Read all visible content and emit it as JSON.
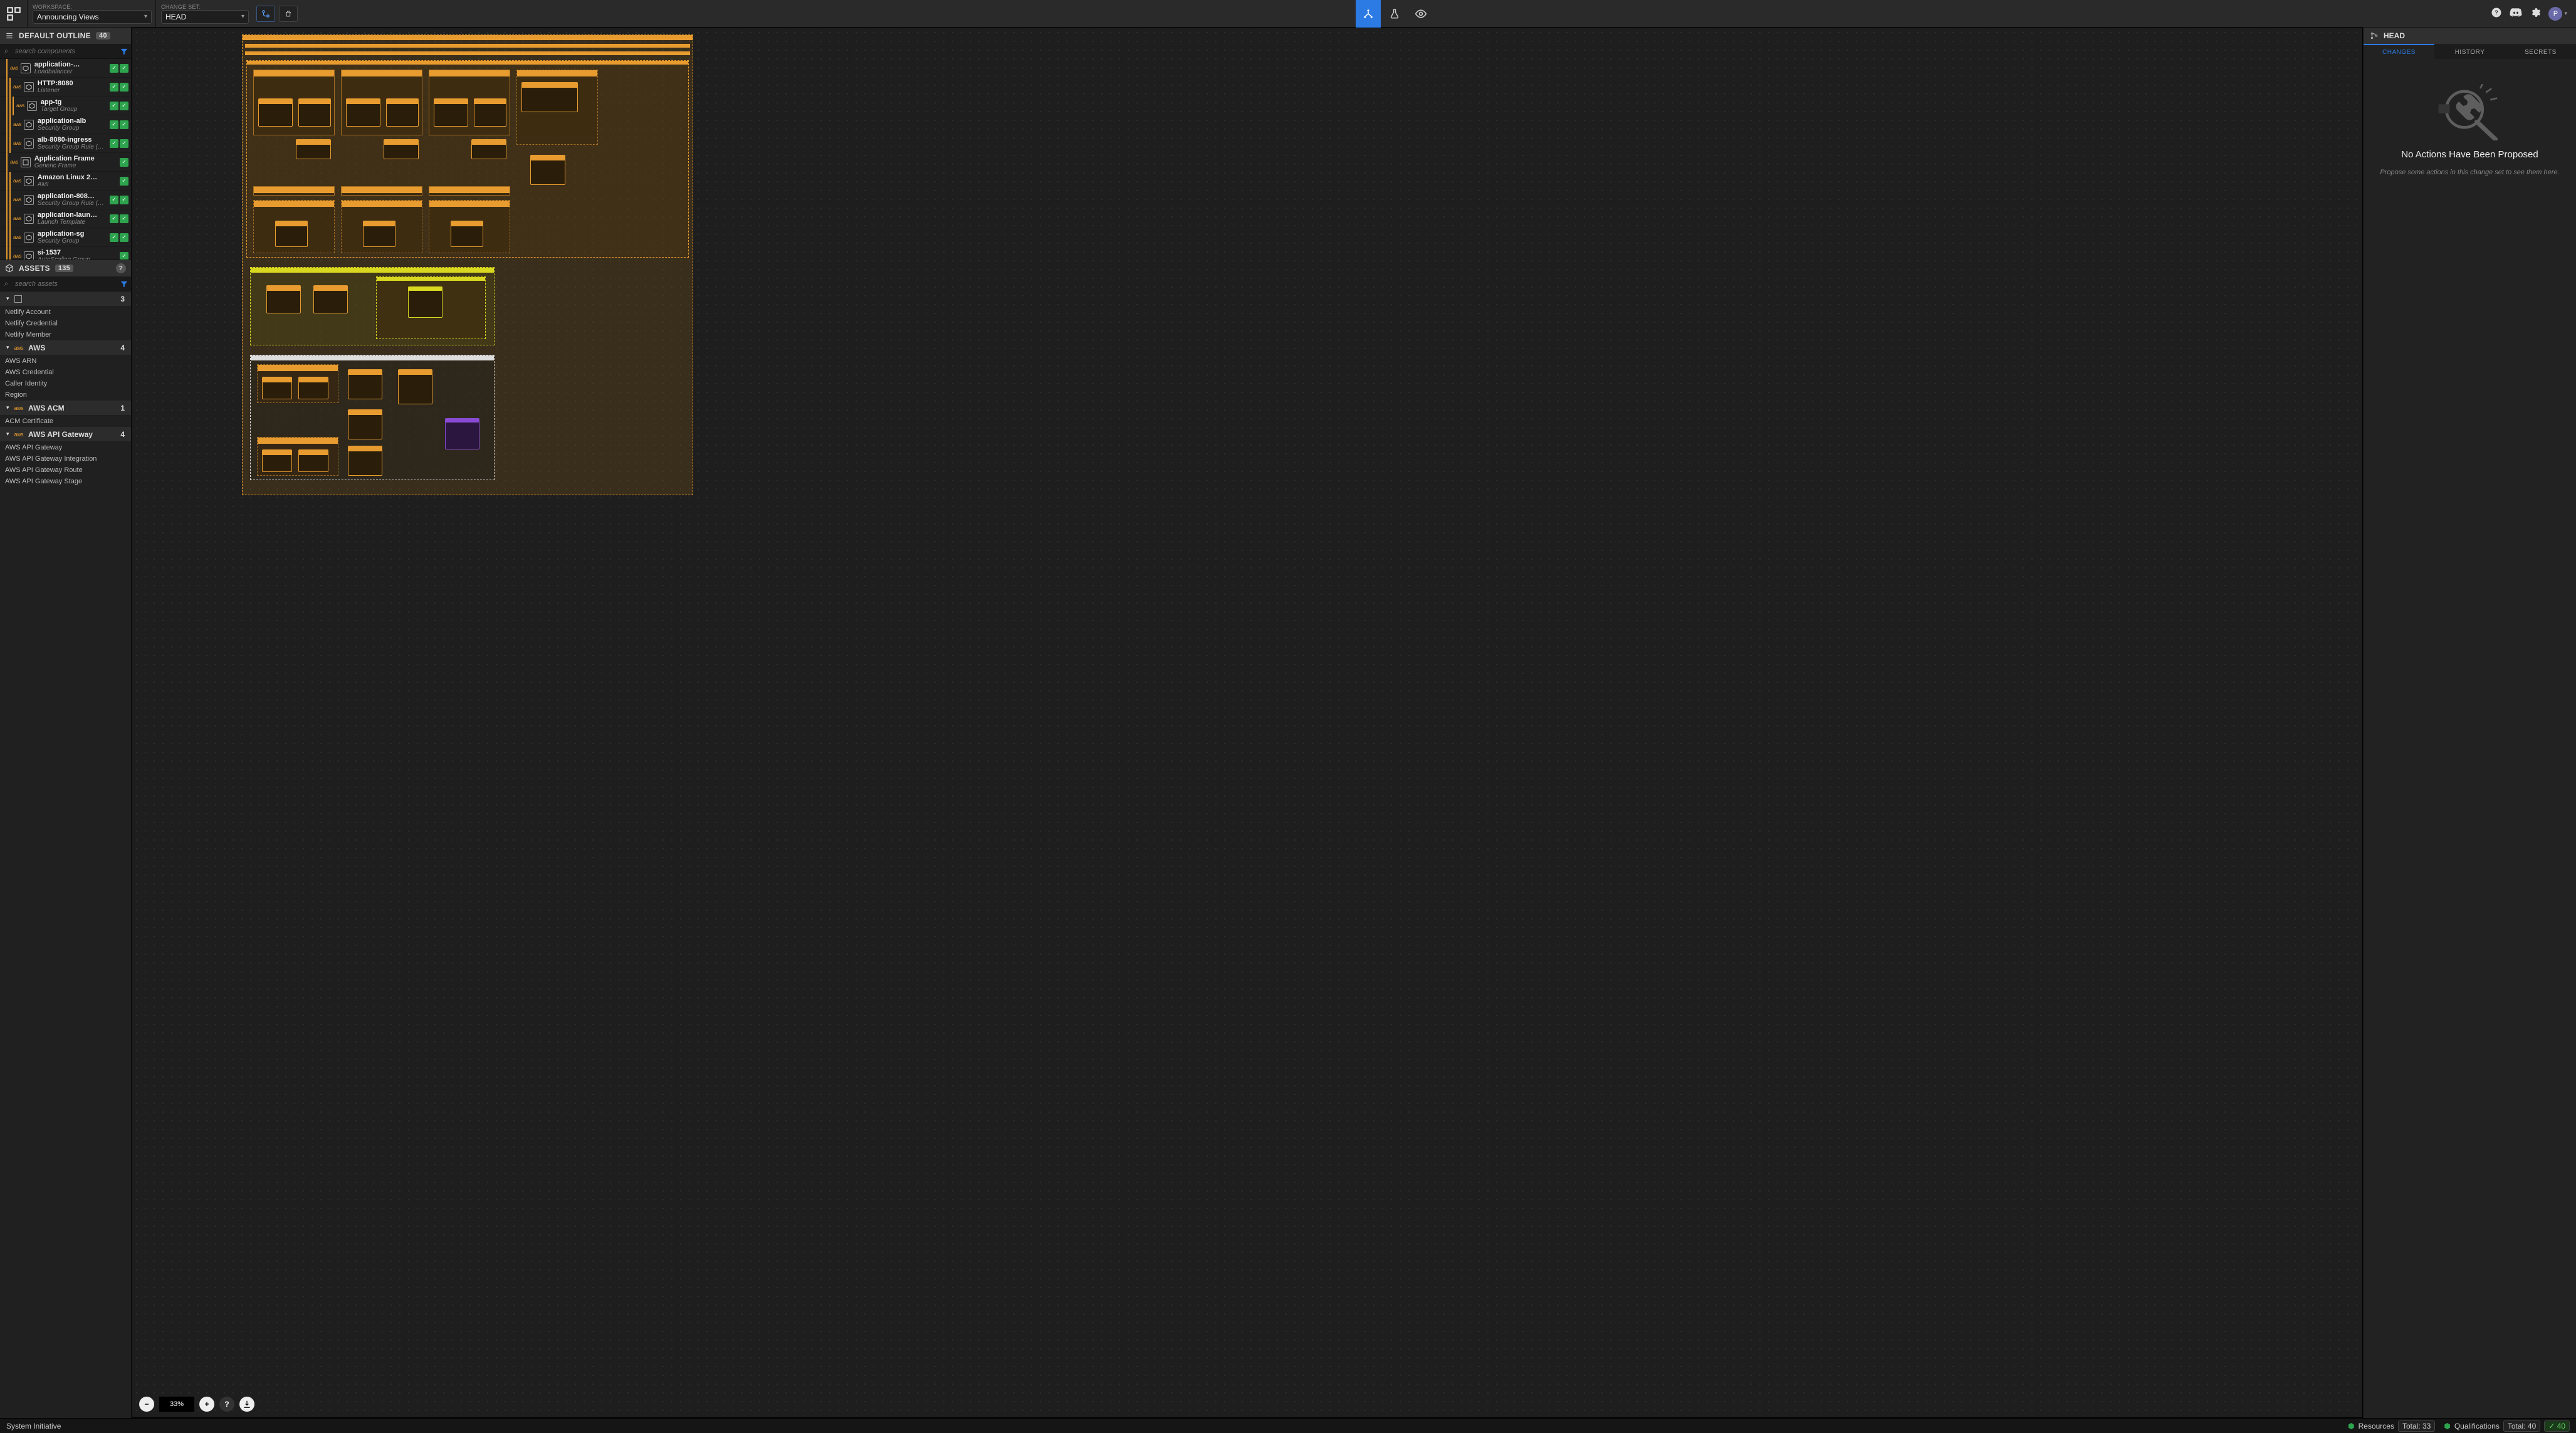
{
  "topbar": {
    "workspace_label": "WORKSPACE:",
    "workspace_value": "Announcing Views",
    "changeset_label": "CHANGE SET:",
    "changeset_value": "HEAD"
  },
  "outline": {
    "title": "DEFAULT OUTLINE",
    "count": "40",
    "search_placeholder": "search components",
    "items": [
      {
        "name": "application-…",
        "type": "Loadbalancer",
        "depth": 1,
        "checks": 2
      },
      {
        "name": "HTTP:8080",
        "type": "Listener",
        "depth": 2,
        "checks": 2
      },
      {
        "name": "app-tg",
        "type": "Target Group",
        "depth": 3,
        "checks": 2
      },
      {
        "name": "application-alb",
        "type": "Security Group",
        "depth": 2,
        "checks": 2
      },
      {
        "name": "alb-8080-ingress",
        "type": "Security Group Rule (…",
        "depth": 2,
        "checks": 2
      },
      {
        "name": "Application Frame",
        "type": "Generic Frame",
        "depth": 1,
        "checks": 1,
        "frame": true
      },
      {
        "name": "Amazon Linux 2…",
        "type": "AMI",
        "depth": 2,
        "checks": 1
      },
      {
        "name": "application-808…",
        "type": "Security Group Rule (…",
        "depth": 2,
        "checks": 2
      },
      {
        "name": "application-laun…",
        "type": "Launch Template",
        "depth": 2,
        "checks": 2
      },
      {
        "name": "application-sg",
        "type": "Security Group",
        "depth": 2,
        "checks": 2
      },
      {
        "name": "si-1537",
        "type": "AutoScaling Group",
        "depth": 2,
        "checks": 1
      }
    ]
  },
  "assets": {
    "title": "ASSETS",
    "count": "135",
    "search_placeholder": "search assets",
    "groups": [
      {
        "name": "",
        "count": "3",
        "aws": false,
        "items": [
          "Netlify Account",
          "Netlify Credential",
          "Netlify Member"
        ]
      },
      {
        "name": "AWS",
        "count": "4",
        "aws": true,
        "items": [
          "AWS ARN",
          "AWS Credential",
          "Caller Identity",
          "Region"
        ]
      },
      {
        "name": "AWS ACM",
        "count": "1",
        "aws": true,
        "items": [
          "ACM Certificate"
        ]
      },
      {
        "name": "AWS API Gateway",
        "count": "4",
        "aws": true,
        "items": [
          "AWS API Gateway",
          "AWS API Gateway Integration",
          "AWS API Gateway Route",
          "AWS API Gateway Stage"
        ]
      }
    ]
  },
  "zoom": "33%",
  "right": {
    "head": "HEAD",
    "tabs": [
      "CHANGES",
      "HISTORY",
      "SECRETS"
    ],
    "empty_title": "No Actions Have Been Proposed",
    "empty_sub": "Propose some actions in this change set to see them here."
  },
  "status": {
    "brand": "System Initiative",
    "resources_label": "Resources",
    "resources_total": "Total: 33",
    "quals_label": "Qualifications",
    "quals_total": "Total: 40",
    "quals_ok": "40"
  }
}
